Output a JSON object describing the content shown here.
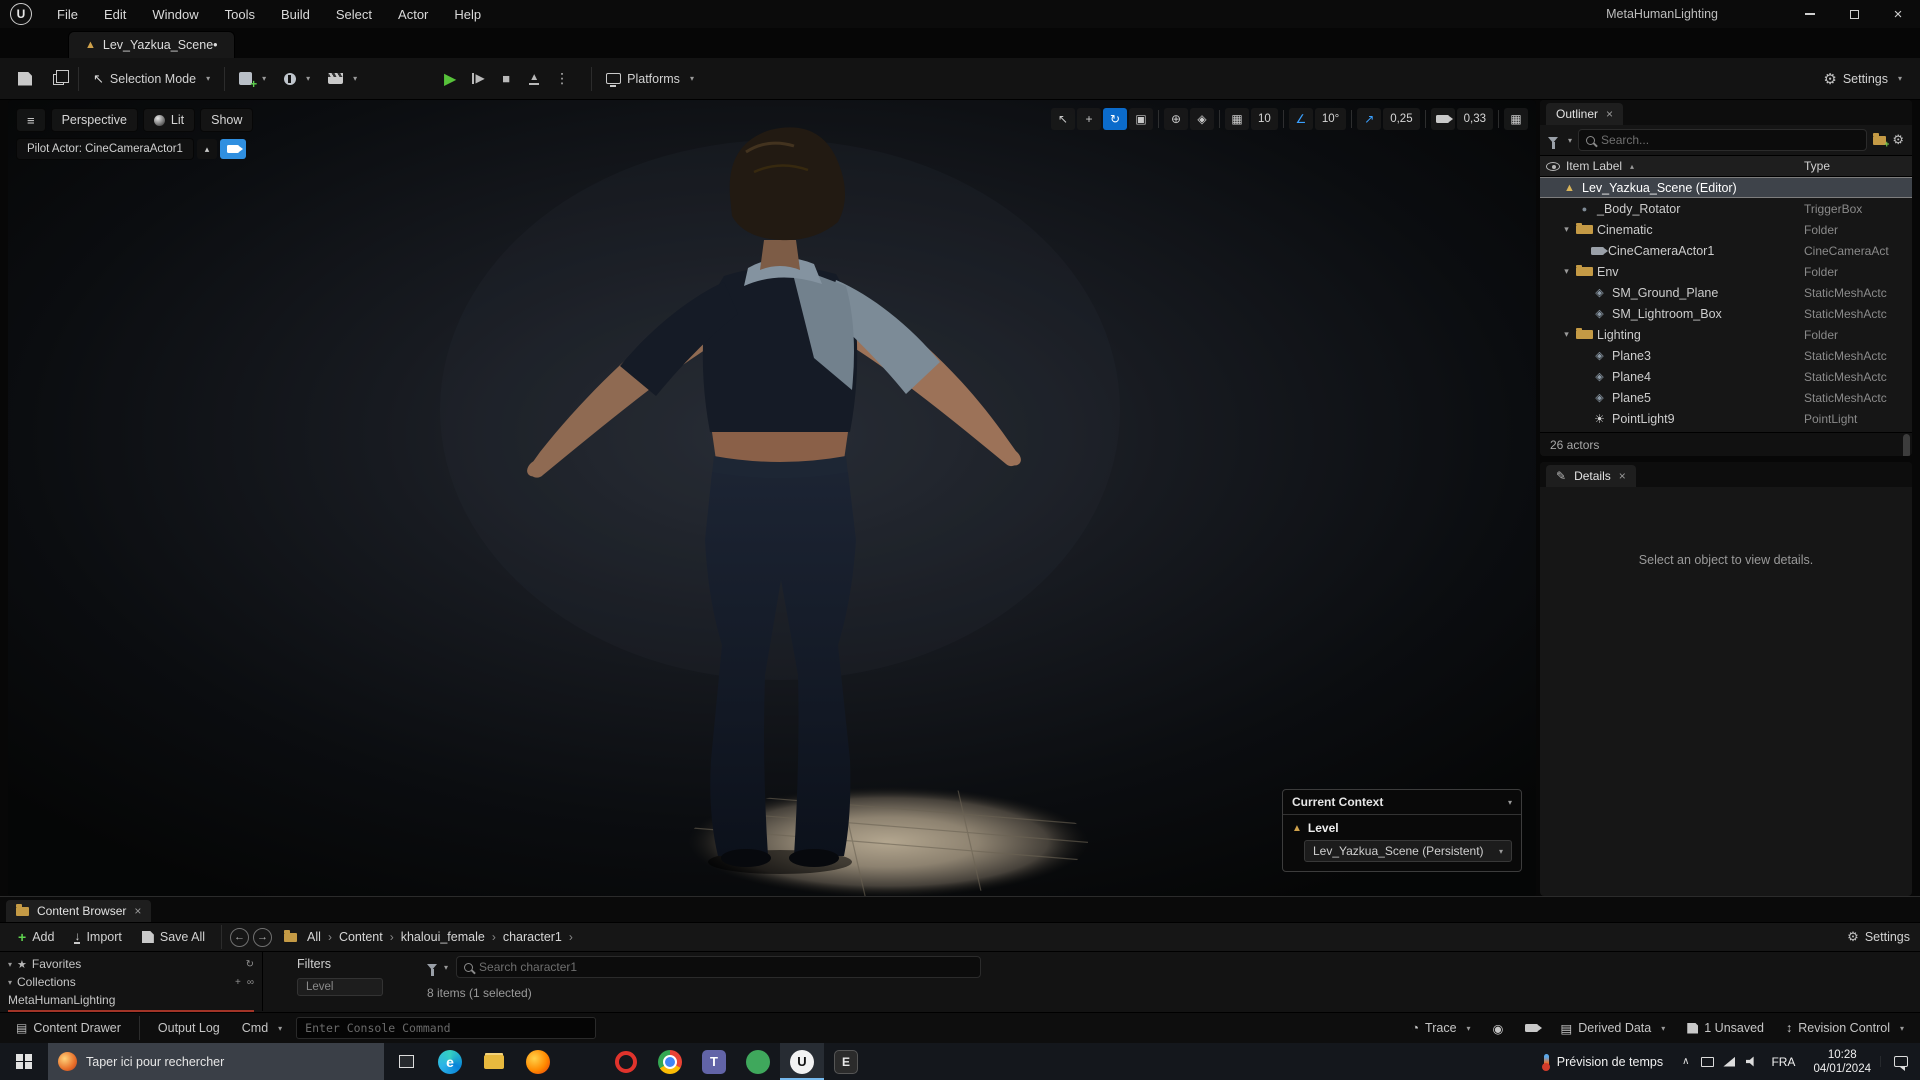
{
  "colors": {
    "accent_blue": "#0b6bcb",
    "play_green": "#57c23a",
    "add_green": "#5fd34f",
    "gold": "#cfa14b",
    "red_line": "#a23427"
  },
  "icons": {
    "hamburger": "≡",
    "chevron": "▾",
    "chevron-up": "▴",
    "close": "×",
    "gear": "⚙",
    "kebab": "⋮",
    "play": "▶",
    "stop": "■",
    "eject": "▲",
    "cursor": "↖",
    "move": "+",
    "rotate": "↻",
    "scale": "▣",
    "globe": "⊕",
    "surface": "◈",
    "grid": "▦",
    "angle": "∠",
    "arrow-ne": "↗",
    "maximize": "▦",
    "level": "▲",
    "sphere": "●",
    "folder": "",
    "camera": "",
    "mesh": "◈",
    "light": "☀",
    "sort": "▴",
    "pencil": "✎",
    "back": "←",
    "forward": "→",
    "plus": "+",
    "star": "★",
    "trace": "◔",
    "record": "◉",
    "derived": "▤",
    "revision": "↕",
    "drawer": "▤",
    "import": "↓",
    "sync": "↻",
    "link": "∞",
    "tray-chev": "∧",
    "crumb-sep": "›"
  },
  "menubar": {
    "title": "MetaHumanLighting",
    "menus": [
      "File",
      "Edit",
      "Window",
      "Tools",
      "Build",
      "Select",
      "Actor",
      "Help"
    ]
  },
  "tab": {
    "label": "Lev_Yazkua_Scene•"
  },
  "toolbar": {
    "selection_mode": "Selection Mode",
    "platforms": "Platforms",
    "settings": "Settings"
  },
  "viewport": {
    "perspective": "Perspective",
    "lit": "Lit",
    "show": "Show",
    "pilot": "Pilot Actor: CineCameraActor1",
    "grid_snap": "10",
    "angle_snap": "10°",
    "scale_snap": "0,25",
    "camera_speed": "0,33"
  },
  "current_context": {
    "title": "Current Context",
    "level_label": "Level",
    "level_value": "Lev_Yazkua_Scene (Persistent)"
  },
  "outliner": {
    "title": "Outliner",
    "search_placeholder": "Search...",
    "col_item": "Item Label",
    "col_type": "Type",
    "footer": "26 actors",
    "rows": [
      {
        "label": "Lev_Yazkua_Scene (Editor)",
        "type": "",
        "indent": 0,
        "icon": "level",
        "selected": true,
        "expand": false
      },
      {
        "label": "_Body_Rotator",
        "type": "TriggerBox",
        "indent": 1,
        "icon": "sphere",
        "expand": false
      },
      {
        "label": "Cinematic",
        "type": "Folder",
        "indent": 1,
        "icon": "folder",
        "expand": true
      },
      {
        "label": "CineCameraActor1",
        "type": "CineCameraAct",
        "indent": 2,
        "icon": "camera",
        "expand": false
      },
      {
        "label": "Env",
        "type": "Folder",
        "indent": 1,
        "icon": "folder",
        "expand": true
      },
      {
        "label": "SM_Ground_Plane",
        "type": "StaticMeshActc",
        "indent": 2,
        "icon": "mesh",
        "expand": false
      },
      {
        "label": "SM_Lightroom_Box",
        "type": "StaticMeshActc",
        "indent": 2,
        "icon": "mesh",
        "expand": false
      },
      {
        "label": "Lighting",
        "type": "Folder",
        "indent": 1,
        "icon": "folder",
        "expand": true
      },
      {
        "label": "Plane3",
        "type": "StaticMeshActc",
        "indent": 2,
        "icon": "mesh",
        "expand": false
      },
      {
        "label": "Plane4",
        "type": "StaticMeshActc",
        "indent": 2,
        "icon": "mesh",
        "expand": false
      },
      {
        "label": "Plane5",
        "type": "StaticMeshActc",
        "indent": 2,
        "icon": "mesh",
        "expand": false
      },
      {
        "label": "PointLight9",
        "type": "PointLight",
        "indent": 2,
        "icon": "light",
        "expand": false
      }
    ]
  },
  "details": {
    "title": "Details",
    "empty": "Select an object to view details."
  },
  "content_browser": {
    "tab": "Content Browser",
    "add": "Add",
    "import": "Import",
    "save_all": "Save All",
    "breadcrumbs": [
      "All",
      "Content",
      "khaloui_female",
      "character1"
    ],
    "settings": "Settings",
    "favorites": "Favorites",
    "collections": "Collections",
    "metahuman": "MetaHumanLighting",
    "filters": "Filters",
    "filter_chip": "Level",
    "search_placeholder": "Search character1",
    "status": "8 items (1 selected)"
  },
  "status_bar": {
    "content_drawer": "Content Drawer",
    "output_log": "Output Log",
    "cmd": "Cmd",
    "console_placeholder": "Enter Console Command",
    "trace": "Trace",
    "derived_data": "Derived Data",
    "unsaved": "1 Unsaved",
    "revision": "Revision Control"
  },
  "taskbar": {
    "search_placeholder": "Taper ici pour rechercher",
    "weather": "Prévision de temps",
    "lang": "FRA",
    "time": "10:28",
    "date": "04/01/2024",
    "apps": [
      {
        "id": "edge"
      },
      {
        "id": "explorer"
      },
      {
        "id": "firefox"
      },
      {
        "id": "mail"
      },
      {
        "id": "opera"
      },
      {
        "id": "chrome"
      },
      {
        "id": "teams"
      },
      {
        "id": "app-green"
      },
      {
        "id": "unreal",
        "active": true
      },
      {
        "id": "epic"
      }
    ]
  }
}
